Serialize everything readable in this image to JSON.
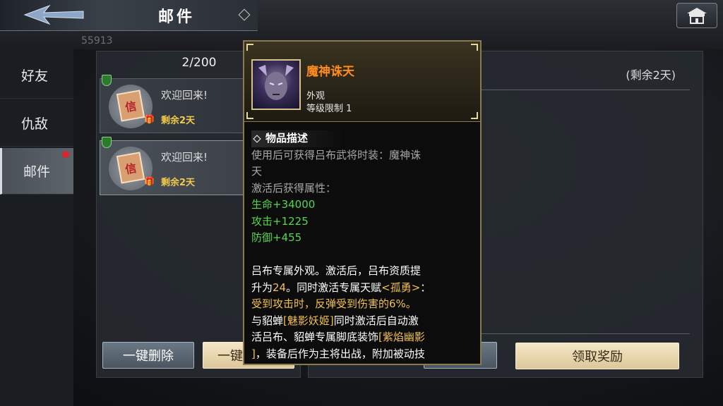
{
  "header": {
    "title": "邮件"
  },
  "ghost": {
    "number": "55913"
  },
  "nav": {
    "items": [
      {
        "label": "好友"
      },
      {
        "label": "仇敌"
      },
      {
        "label": "邮件"
      }
    ]
  },
  "mail_list": {
    "count": "2/200",
    "items": [
      {
        "title": "欢迎回来!",
        "remain": "剩余2天",
        "letter_char": "信"
      },
      {
        "title": "欢迎回来!",
        "remain": "剩余2天",
        "letter_char": "信"
      }
    ]
  },
  "detail": {
    "remain": "(剩余2天)"
  },
  "buttons": {
    "delete_all": "一键删除",
    "claim_all_partial": "一键",
    "claim_reward": "领取奖励"
  },
  "tooltip": {
    "name": "魔神诛天",
    "type": "外观",
    "level": "等级限制 1",
    "section_title": "物品描述",
    "desc_line1": "使用后可获得吕布武将时装：魔神诛",
    "desc_line2": "天",
    "activate_line": "激活后获得属性：",
    "stat_hp": "生命+34000",
    "stat_atk": "攻击+1225",
    "stat_def": "防御+455",
    "exclusive_1": "吕布专属外观。激活后，吕布资质提",
    "exclusive_2a": "升为",
    "exclusive_2b": "24",
    "exclusive_2c": "。同时激活专属天赋",
    "exclusive_2d": "<孤勇>",
    "exclusive_2e": "：",
    "exclusive_3": "受到攻击时，反弹受到伤害的6%。",
    "pair_1a": "与貂蝉",
    "pair_1b": "[魅影妖姬]",
    "pair_1c": "同时激活后自动激",
    "pair_2a": "活吕布、貂蝉专属脚底装饰",
    "pair_2b": "[紫焰幽影",
    "pair_3a": "]",
    "pair_3b": "，装备后作为主将出战，附加被动技"
  },
  "colors": {
    "name_orange": "#ff8c1a",
    "stat_green": "#55d650",
    "highlight_yellow": "#f2c14e",
    "badge_red": "#d9262d",
    "tooltip_border": "#8a7a50"
  }
}
